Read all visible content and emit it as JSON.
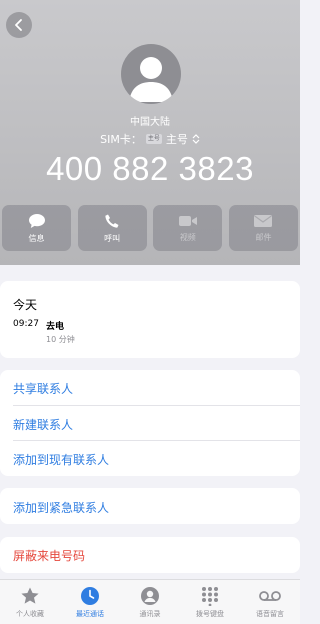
{
  "header": {
    "region": "中国大陆",
    "sim_label": "SIM卡：",
    "sim_badge": "主号",
    "sim_value": "主号",
    "phone_number": "400 882 3823"
  },
  "actions": [
    {
      "label": "信息",
      "icon": "message-icon",
      "enabled": true
    },
    {
      "label": "呼叫",
      "icon": "phone-icon",
      "enabled": true
    },
    {
      "label": "视频",
      "icon": "video-icon",
      "enabled": false
    },
    {
      "label": "邮件",
      "icon": "mail-icon",
      "enabled": false
    }
  ],
  "recent": {
    "day": "今天",
    "time": "09:27",
    "type": "去电",
    "duration": "10 分钟"
  },
  "menu": {
    "share_contact": "共享联系人",
    "new_contact": "新建联系人",
    "add_existing": "添加到现有联系人",
    "add_emergency": "添加到紧急联系人",
    "block_caller": "屏蔽来电号码"
  },
  "tabbar": [
    {
      "label": "个人收藏",
      "icon": "star-icon",
      "active": false
    },
    {
      "label": "最近通话",
      "icon": "clock-icon",
      "active": true
    },
    {
      "label": "通讯录",
      "icon": "person-icon",
      "active": false
    },
    {
      "label": "拨号键盘",
      "icon": "keypad-icon",
      "active": false
    },
    {
      "label": "语音留言",
      "icon": "voicemail-icon",
      "active": false
    }
  ],
  "colors": {
    "accent": "#2f7de1",
    "destructive": "#e5483d",
    "header_bg": "#bfbfc2"
  }
}
